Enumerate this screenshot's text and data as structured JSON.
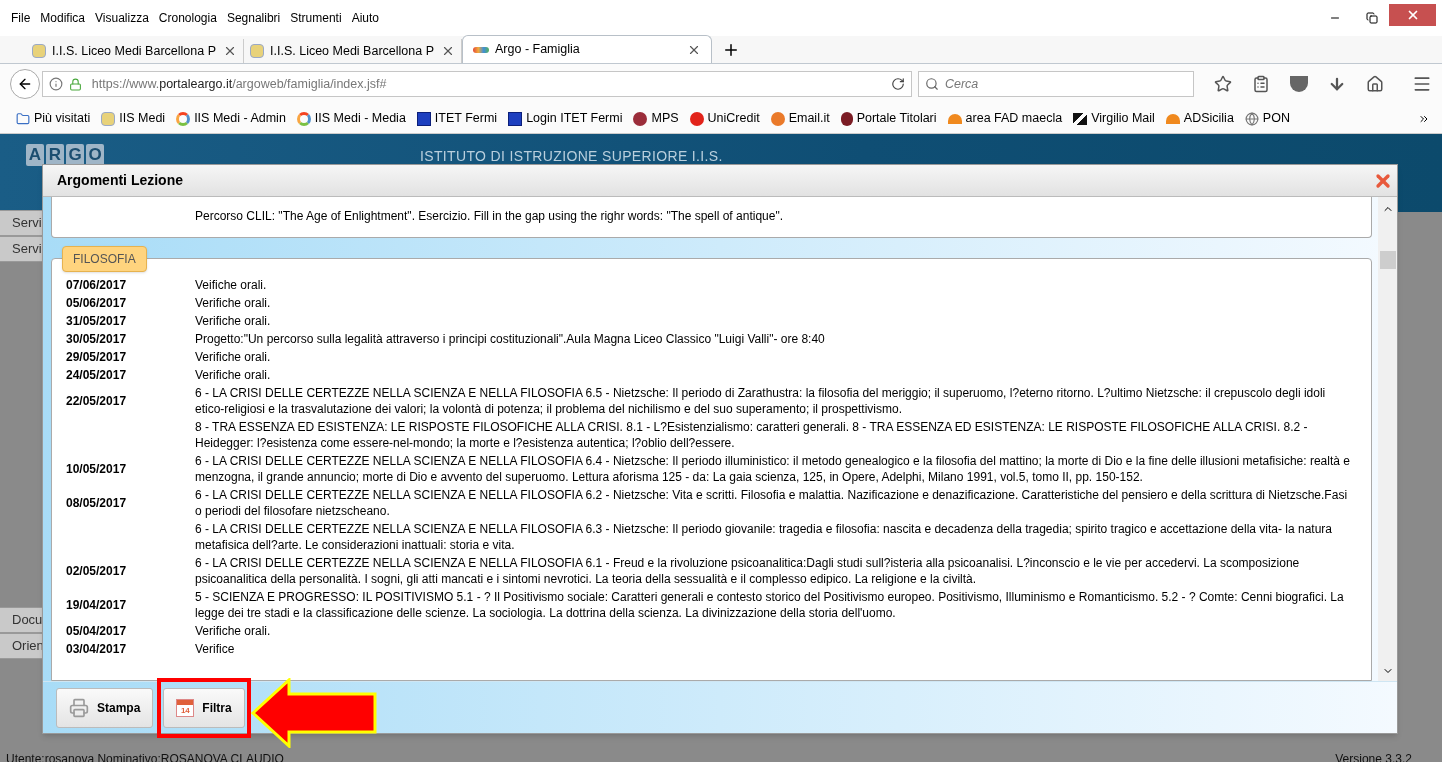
{
  "menu": [
    "File",
    "Modifica",
    "Visualizza",
    "Cronologia",
    "Segnalibri",
    "Strumenti",
    "Aiuto"
  ],
  "tabs": [
    {
      "title": "I.I.S. Liceo Medi Barcellona P",
      "selected": false
    },
    {
      "title": "I.I.S. Liceo Medi Barcellona P",
      "selected": false
    },
    {
      "title": "Argo - Famiglia",
      "selected": true
    }
  ],
  "address": {
    "prefix": "https://www.",
    "domain": "portaleargo.it",
    "path": "/argoweb/famiglia/index.jsf#"
  },
  "search": {
    "placeholder": "Cerca"
  },
  "bookmarks": [
    "Più visitati",
    "IIS Medi",
    "IIS Medi - Admin",
    "IIS Medi - Media",
    "ITET Fermi",
    "Login ITET Fermi",
    "MPS",
    "UniCredit",
    "Email.it",
    "Portale Titolari",
    "area FAD maecla",
    "Virgilio Mail",
    "ADSicilia",
    "PON"
  ],
  "page": {
    "logo": [
      "A",
      "R",
      "G",
      "O"
    ],
    "institute": "ISTITUTO DI ISTRUZIONE SUPERIORE I.I.S.",
    "sidebar": [
      "Servi",
      "Servi",
      "Docu",
      "Orien"
    ]
  },
  "dialog": {
    "title": "Argomenti Lezione",
    "previous_section": {
      "rows": [
        {
          "text": "Percorso CLIL: \"The Age of Enlightment\". Esercizio. Fill in the gap using the righr words: \"The spell of antique\"."
        }
      ]
    },
    "section": {
      "subject": "FILOSOFIA",
      "rows": [
        {
          "date": "07/06/2017",
          "text": "Veifiche orali."
        },
        {
          "date": "05/06/2017",
          "text": "Verifiche orali."
        },
        {
          "date": "31/05/2017",
          "text": "Verifiche orali."
        },
        {
          "date": "30/05/2017",
          "text": "Progetto:\"Un percorso sulla legalità attraverso i principi costituzionali\".Aula Magna Liceo Classico \"Luigi Valli\"- ore 8:40"
        },
        {
          "date": "29/05/2017",
          "text": "Verifiche orali."
        },
        {
          "date": "24/05/2017",
          "text": "Verifiche orali."
        },
        {
          "date": "22/05/2017",
          "text": "6 - LA CRISI DELLE CERTEZZE NELLA SCIENZA E NELLA FILOSOFIA 6.5 - Nietzsche: Il periodo di Zarathustra: la filosofia del meriggio; il superuomo, l?eterno ritorno. L?ultimo Nietzsche: il crepuscolo degli idoli etico-religiosi e la trasvalutazione dei valori; la volontà di potenza; il problema del nichilismo e del suo superamento; il prospettivismo."
        },
        {
          "text": "8 - TRA ESSENZA ED ESISTENZA: LE RISPOSTE FILOSOFICHE ALLA CRISI. 8.1 - L?Esistenzialismo: caratteri generali. 8 - TRA ESSENZA ED ESISTENZA: LE RISPOSTE FILOSOFICHE ALLA CRISI. 8.2 - Heidegger: l?esistenza come essere-nel-mondo; la morte e l?esistenza autentica; l?oblio dell?essere."
        },
        {
          "date": "10/05/2017",
          "text": "6 - LA CRISI DELLE CERTEZZE NELLA SCIENZA E NELLA FILOSOFIA 6.4 - Nietzsche: Il periodo illuministico: il metodo genealogico e la filosofia del mattino; la morte di Dio e la fine delle illusioni metafisiche: realtà e menzogna, il grande annuncio; morte di Dio e avvento del superuomo. Lettura aforisma 125 - da: La gaia scienza, 125, in Opere, Adelphi, Milano 1991, vol.5, tomo II, pp. 150-152."
        },
        {
          "date": "08/05/2017",
          "text": "6 - LA CRISI DELLE CERTEZZE NELLA SCIENZA E NELLA FILOSOFIA 6.2 - Nietzsche: Vita e scritti. Filosofia e malattia. Nazificazione e denazificazione. Caratteristiche del pensiero e della scrittura di Nietzsche.Fasi o periodi del filosofare nietzscheano."
        },
        {
          "text": "6 - LA CRISI DELLE CERTEZZE NELLA SCIENZA E NELLA FILOSOFIA 6.3 - Nietzsche: Il periodo giovanile: tragedia e filosofia: nascita e decadenza della tragedia; spirito tragico e accettazione della vita- la natura metafisica dell?arte. Le considerazioni inattuali: storia e vita."
        },
        {
          "date": "02/05/2017",
          "text": "6 - LA CRISI DELLE CERTEZZE NELLA SCIENZA E NELLA FILOSOFIA 6.1 - Freud e la rivoluzione psicoanalitica:Dagli studi sull?isteria alla psicoanalisi. L?inconscio e le vie per accedervi. La scomposizione psicoanalitica della personalità. I sogni, gli atti mancati e i sintomi nevrotici. La teoria della sessualità e il complesso edipico. La religione e la civiltà."
        },
        {
          "date": "19/04/2017",
          "text": "5 - SCIENZA E PROGRESSO: IL POSITIVISMO 5.1 - ? Il Positivismo sociale: Caratteri generali e contesto storico del Positivismo europeo. Positivismo, Illuminismo e Romanticismo. 5.2 - ? Comte: Cenni biografici. La legge dei tre stadi e la classificazione delle scienze. La sociologia. La dottrina della scienza. La divinizzazione della storia dell'uomo."
        },
        {
          "date": "05/04/2017",
          "text": "Verifiche orali."
        },
        {
          "date": "03/04/2017",
          "text": "Verifice"
        }
      ]
    },
    "buttons": [
      {
        "label": "Stampa",
        "kind": "print",
        "highlighted": false
      },
      {
        "label": "Filtra",
        "kind": "filter",
        "calendar_day": "14",
        "highlighted": true
      }
    ]
  },
  "status_bar": {
    "user": "Utente:rosanova Nominativo:ROSANOVA CLAUDIO",
    "version": "Versione 3.3.2"
  }
}
